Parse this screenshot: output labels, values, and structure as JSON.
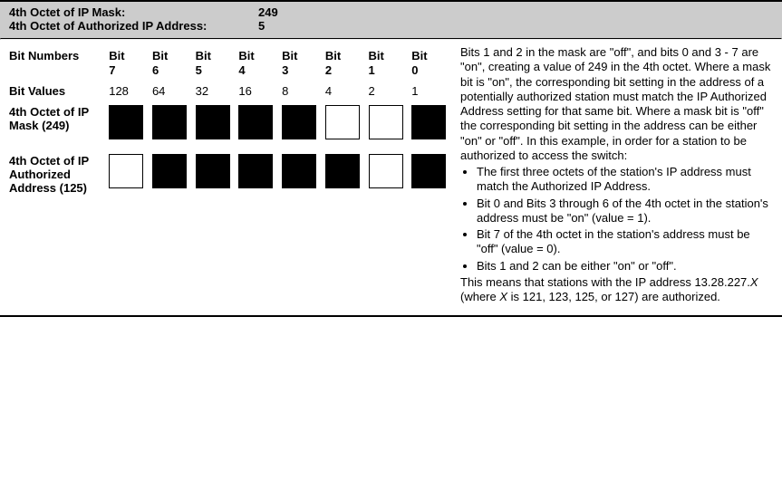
{
  "header": {
    "mask_label": "4th Octet of IP Mask:",
    "mask_value": "249",
    "addr_label": "4th Octet of Authorized IP Address:",
    "addr_value": "5"
  },
  "table": {
    "row_bitnumbers_label": "Bit Numbers",
    "row_bitvalues_label": "Bit Values",
    "row_mask_label": "4th Octet of IP Mask (249)",
    "row_addr_label": "4th Octet of IP Authorized Address (125)",
    "bits": [
      {
        "num": "Bit 7",
        "val": "128",
        "mask_on": true,
        "addr_on": false
      },
      {
        "num": "Bit 6",
        "val": "64",
        "mask_on": true,
        "addr_on": true
      },
      {
        "num": "Bit 5",
        "val": "32",
        "mask_on": true,
        "addr_on": true
      },
      {
        "num": "Bit 4",
        "val": "16",
        "mask_on": true,
        "addr_on": true
      },
      {
        "num": "Bit 3",
        "val": "8",
        "mask_on": true,
        "addr_on": true
      },
      {
        "num": "Bit 2",
        "val": "4",
        "mask_on": false,
        "addr_on": true
      },
      {
        "num": "Bit 1",
        "val": "2",
        "mask_on": false,
        "addr_on": false
      },
      {
        "num": "Bit 0",
        "val": "1",
        "mask_on": true,
        "addr_on": true
      }
    ]
  },
  "explain": {
    "para1": "Bits 1 and 2 in the mask are \"off\", and bits 0 and 3 - 7 are \"on\", creating a value of 249 in the 4th octet. Where a mask bit is \"on\", the corresponding bit setting in the address of a potentially authorized station must match the IP Authorized Address setting for that same bit. Where a mask bit is \"off\" the corresponding bit setting in the address can be either \"on\" or \"off\". In this example, in order for a station to be authorized to access the switch:",
    "bullets": [
      "The first three octets of the station's IP address must match the Authorized IP Address.",
      "Bit 0 and Bits 3 through 6 of the 4th octet in the station's address must be \"on\" (value = 1).",
      "Bit 7 of the 4th octet in the station's address must be \"off\" (value = 0).",
      "Bits 1 and 2 can be either \"on\" or \"off\"."
    ],
    "para2_a": "This means that stations with the IP address 13.28.227.",
    "para2_x": "X",
    "para2_b": " (where ",
    "para2_x2": "X",
    "para2_c": " is 121, 123, 125, or 127) are authorized."
  },
  "chart_data": {
    "type": "table",
    "title": "4th Octet Bit Pattern for IP Mask and Authorized Address",
    "columns": [
      "Bit 7",
      "Bit 6",
      "Bit 5",
      "Bit 4",
      "Bit 3",
      "Bit 2",
      "Bit 1",
      "Bit 0"
    ],
    "bit_values": [
      128,
      64,
      32,
      16,
      8,
      4,
      2,
      1
    ],
    "series": [
      {
        "name": "4th Octet of IP Mask (249)",
        "values": [
          1,
          1,
          1,
          1,
          1,
          0,
          0,
          1
        ]
      },
      {
        "name": "4th Octet of IP Authorized Address (125)",
        "values": [
          0,
          1,
          1,
          1,
          1,
          1,
          0,
          1
        ]
      }
    ]
  }
}
